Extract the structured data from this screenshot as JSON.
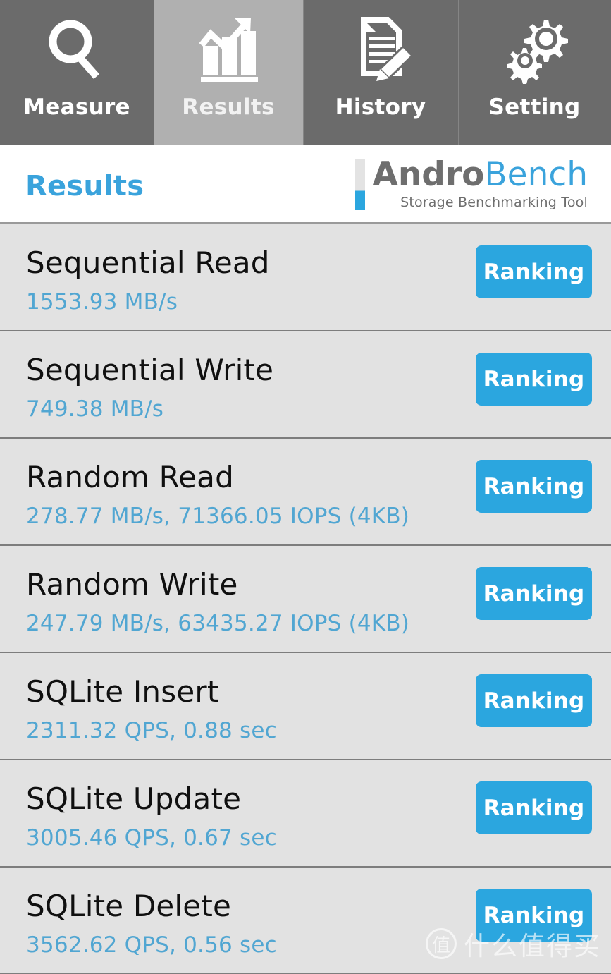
{
  "tabs": [
    {
      "id": "measure",
      "label": "Measure",
      "icon": "magnifier-icon",
      "active": false
    },
    {
      "id": "results",
      "label": "Results",
      "icon": "bar-chart-icon",
      "active": true
    },
    {
      "id": "history",
      "label": "History",
      "icon": "document-pencil-icon",
      "active": false
    },
    {
      "id": "setting",
      "label": "Setting",
      "icon": "gears-icon",
      "active": false
    }
  ],
  "header": {
    "title": "Results",
    "logo_primary": "Andro",
    "logo_secondary": "Bench",
    "logo_tagline": "Storage Benchmarking Tool"
  },
  "results": [
    {
      "label": "Sequential Read",
      "value": "1553.93 MB/s",
      "action": "Ranking"
    },
    {
      "label": "Sequential Write",
      "value": "749.38 MB/s",
      "action": "Ranking"
    },
    {
      "label": "Random Read",
      "value": "278.77 MB/s, 71366.05 IOPS (4KB)",
      "action": "Ranking"
    },
    {
      "label": "Random Write",
      "value": "247.79 MB/s, 63435.27 IOPS (4KB)",
      "action": "Ranking"
    },
    {
      "label": "SQLite Insert",
      "value": "2311.32 QPS, 0.88 sec",
      "action": "Ranking"
    },
    {
      "label": "SQLite Update",
      "value": "3005.46 QPS, 0.67 sec",
      "action": "Ranking"
    },
    {
      "label": "SQLite Delete",
      "value": "3562.62 QPS, 0.56 sec",
      "action": "Ranking"
    }
  ],
  "watermark": {
    "badge": "值",
    "text": "什么值得买"
  },
  "colors": {
    "accent_blue": "#2ba6df",
    "title_blue": "#3aa3dc",
    "value_blue": "#51a6d2",
    "tab_inactive": "#6b6b6b",
    "tab_active": "#b0b0b0",
    "list_bg": "#e2e2e2",
    "divider": "#7d7d7d"
  }
}
